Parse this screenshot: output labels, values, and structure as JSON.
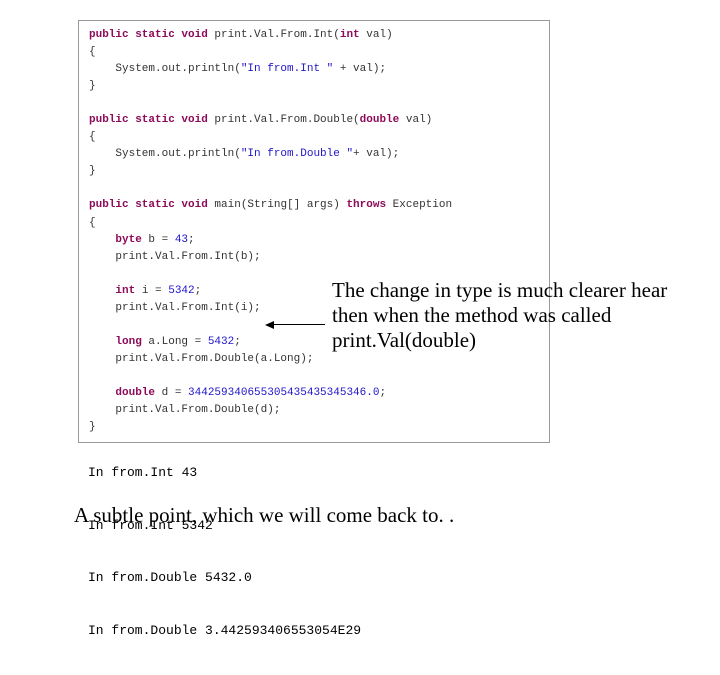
{
  "code": {
    "m1_sig_a": "public static void",
    "m1_sig_b": " print.Val.From.Int(",
    "m1_sig_c": "int",
    "m1_sig_d": " val)",
    "m1_open": "{",
    "m1_body_a": "    System.out.println(",
    "m1_body_b": "\"In from.Int \"",
    "m1_body_c": " + val);",
    "m1_close": "}",
    "m2_sig_a": "public static void",
    "m2_sig_b": " print.Val.From.Double(",
    "m2_sig_c": "double",
    "m2_sig_d": " val)",
    "m2_open": "{",
    "m2_body_a": "    System.out.println(",
    "m2_body_b": "\"In from.Double \"",
    "m2_body_c": "+ val);",
    "m2_close": "}",
    "main_sig_a": "public static void",
    "main_sig_b": " main(String[] args) ",
    "main_sig_c": "throws",
    "main_sig_d": " Exception",
    "main_open": "{",
    "byte_a": "    ",
    "byte_b": "byte",
    "byte_c": " b = ",
    "byte_d": "43",
    "byte_e": ";",
    "call1": "    print.Val.From.Int(b);",
    "int_a": "    ",
    "int_b": "int",
    "int_c": " i = ",
    "int_d": "5342",
    "int_e": ";",
    "call2": "    print.Val.From.Int(i);",
    "long_a": "    ",
    "long_b": "long",
    "long_c": " a.Long = ",
    "long_d": "5432",
    "long_e": ";",
    "call3": "    print.Val.From.Double(a.Long);",
    "dbl_a": "    ",
    "dbl_b": "double",
    "dbl_c": " d = ",
    "dbl_d": "344259340655305435435345346.0",
    "dbl_e": ";",
    "call4": "    print.Val.From.Double(d);",
    "main_close": "}"
  },
  "annotation": "The change in type is much clearer hear then when the method was called print.Val(double)",
  "output": {
    "l1": "In from.Int 43",
    "l2": "In from.Int 5342",
    "l3": "In from.Double 5432.0",
    "l4": "In from.Double 3.442593406553054E29"
  },
  "bottom": "A subtle point, which we will come back to. ."
}
